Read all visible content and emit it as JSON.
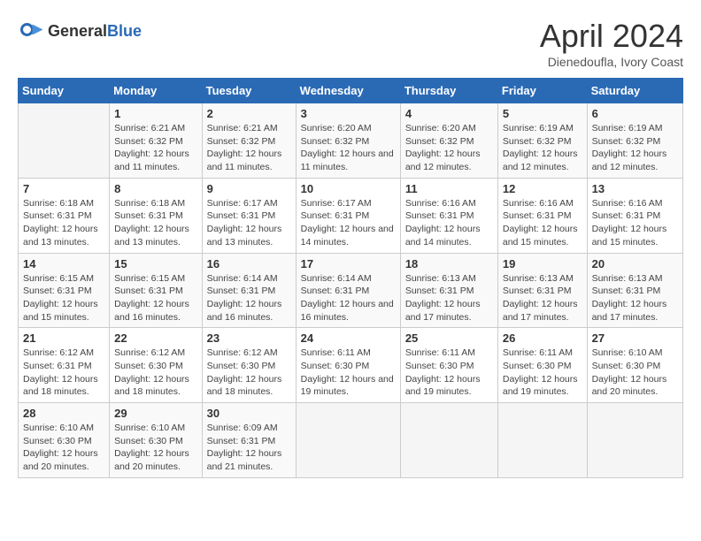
{
  "logo": {
    "general": "General",
    "blue": "Blue"
  },
  "title": "April 2024",
  "location": "Dienedoufla, Ivory Coast",
  "days_of_week": [
    "Sunday",
    "Monday",
    "Tuesday",
    "Wednesday",
    "Thursday",
    "Friday",
    "Saturday"
  ],
  "weeks": [
    [
      {
        "day": "",
        "sunrise": "",
        "sunset": "",
        "daylight": ""
      },
      {
        "day": "1",
        "sunrise": "Sunrise: 6:21 AM",
        "sunset": "Sunset: 6:32 PM",
        "daylight": "Daylight: 12 hours and 11 minutes."
      },
      {
        "day": "2",
        "sunrise": "Sunrise: 6:21 AM",
        "sunset": "Sunset: 6:32 PM",
        "daylight": "Daylight: 12 hours and 11 minutes."
      },
      {
        "day": "3",
        "sunrise": "Sunrise: 6:20 AM",
        "sunset": "Sunset: 6:32 PM",
        "daylight": "Daylight: 12 hours and 11 minutes."
      },
      {
        "day": "4",
        "sunrise": "Sunrise: 6:20 AM",
        "sunset": "Sunset: 6:32 PM",
        "daylight": "Daylight: 12 hours and 12 minutes."
      },
      {
        "day": "5",
        "sunrise": "Sunrise: 6:19 AM",
        "sunset": "Sunset: 6:32 PM",
        "daylight": "Daylight: 12 hours and 12 minutes."
      },
      {
        "day": "6",
        "sunrise": "Sunrise: 6:19 AM",
        "sunset": "Sunset: 6:32 PM",
        "daylight": "Daylight: 12 hours and 12 minutes."
      }
    ],
    [
      {
        "day": "7",
        "sunrise": "Sunrise: 6:18 AM",
        "sunset": "Sunset: 6:31 PM",
        "daylight": "Daylight: 12 hours and 13 minutes."
      },
      {
        "day": "8",
        "sunrise": "Sunrise: 6:18 AM",
        "sunset": "Sunset: 6:31 PM",
        "daylight": "Daylight: 12 hours and 13 minutes."
      },
      {
        "day": "9",
        "sunrise": "Sunrise: 6:17 AM",
        "sunset": "Sunset: 6:31 PM",
        "daylight": "Daylight: 12 hours and 13 minutes."
      },
      {
        "day": "10",
        "sunrise": "Sunrise: 6:17 AM",
        "sunset": "Sunset: 6:31 PM",
        "daylight": "Daylight: 12 hours and 14 minutes."
      },
      {
        "day": "11",
        "sunrise": "Sunrise: 6:16 AM",
        "sunset": "Sunset: 6:31 PM",
        "daylight": "Daylight: 12 hours and 14 minutes."
      },
      {
        "day": "12",
        "sunrise": "Sunrise: 6:16 AM",
        "sunset": "Sunset: 6:31 PM",
        "daylight": "Daylight: 12 hours and 15 minutes."
      },
      {
        "day": "13",
        "sunrise": "Sunrise: 6:16 AM",
        "sunset": "Sunset: 6:31 PM",
        "daylight": "Daylight: 12 hours and 15 minutes."
      }
    ],
    [
      {
        "day": "14",
        "sunrise": "Sunrise: 6:15 AM",
        "sunset": "Sunset: 6:31 PM",
        "daylight": "Daylight: 12 hours and 15 minutes."
      },
      {
        "day": "15",
        "sunrise": "Sunrise: 6:15 AM",
        "sunset": "Sunset: 6:31 PM",
        "daylight": "Daylight: 12 hours and 16 minutes."
      },
      {
        "day": "16",
        "sunrise": "Sunrise: 6:14 AM",
        "sunset": "Sunset: 6:31 PM",
        "daylight": "Daylight: 12 hours and 16 minutes."
      },
      {
        "day": "17",
        "sunrise": "Sunrise: 6:14 AM",
        "sunset": "Sunset: 6:31 PM",
        "daylight": "Daylight: 12 hours and 16 minutes."
      },
      {
        "day": "18",
        "sunrise": "Sunrise: 6:13 AM",
        "sunset": "Sunset: 6:31 PM",
        "daylight": "Daylight: 12 hours and 17 minutes."
      },
      {
        "day": "19",
        "sunrise": "Sunrise: 6:13 AM",
        "sunset": "Sunset: 6:31 PM",
        "daylight": "Daylight: 12 hours and 17 minutes."
      },
      {
        "day": "20",
        "sunrise": "Sunrise: 6:13 AM",
        "sunset": "Sunset: 6:31 PM",
        "daylight": "Daylight: 12 hours and 17 minutes."
      }
    ],
    [
      {
        "day": "21",
        "sunrise": "Sunrise: 6:12 AM",
        "sunset": "Sunset: 6:31 PM",
        "daylight": "Daylight: 12 hours and 18 minutes."
      },
      {
        "day": "22",
        "sunrise": "Sunrise: 6:12 AM",
        "sunset": "Sunset: 6:30 PM",
        "daylight": "Daylight: 12 hours and 18 minutes."
      },
      {
        "day": "23",
        "sunrise": "Sunrise: 6:12 AM",
        "sunset": "Sunset: 6:30 PM",
        "daylight": "Daylight: 12 hours and 18 minutes."
      },
      {
        "day": "24",
        "sunrise": "Sunrise: 6:11 AM",
        "sunset": "Sunset: 6:30 PM",
        "daylight": "Daylight: 12 hours and 19 minutes."
      },
      {
        "day": "25",
        "sunrise": "Sunrise: 6:11 AM",
        "sunset": "Sunset: 6:30 PM",
        "daylight": "Daylight: 12 hours and 19 minutes."
      },
      {
        "day": "26",
        "sunrise": "Sunrise: 6:11 AM",
        "sunset": "Sunset: 6:30 PM",
        "daylight": "Daylight: 12 hours and 19 minutes."
      },
      {
        "day": "27",
        "sunrise": "Sunrise: 6:10 AM",
        "sunset": "Sunset: 6:30 PM",
        "daylight": "Daylight: 12 hours and 20 minutes."
      }
    ],
    [
      {
        "day": "28",
        "sunrise": "Sunrise: 6:10 AM",
        "sunset": "Sunset: 6:30 PM",
        "daylight": "Daylight: 12 hours and 20 minutes."
      },
      {
        "day": "29",
        "sunrise": "Sunrise: 6:10 AM",
        "sunset": "Sunset: 6:30 PM",
        "daylight": "Daylight: 12 hours and 20 minutes."
      },
      {
        "day": "30",
        "sunrise": "Sunrise: 6:09 AM",
        "sunset": "Sunset: 6:31 PM",
        "daylight": "Daylight: 12 hours and 21 minutes."
      },
      {
        "day": "",
        "sunrise": "",
        "sunset": "",
        "daylight": ""
      },
      {
        "day": "",
        "sunrise": "",
        "sunset": "",
        "daylight": ""
      },
      {
        "day": "",
        "sunrise": "",
        "sunset": "",
        "daylight": ""
      },
      {
        "day": "",
        "sunrise": "",
        "sunset": "",
        "daylight": ""
      }
    ]
  ]
}
